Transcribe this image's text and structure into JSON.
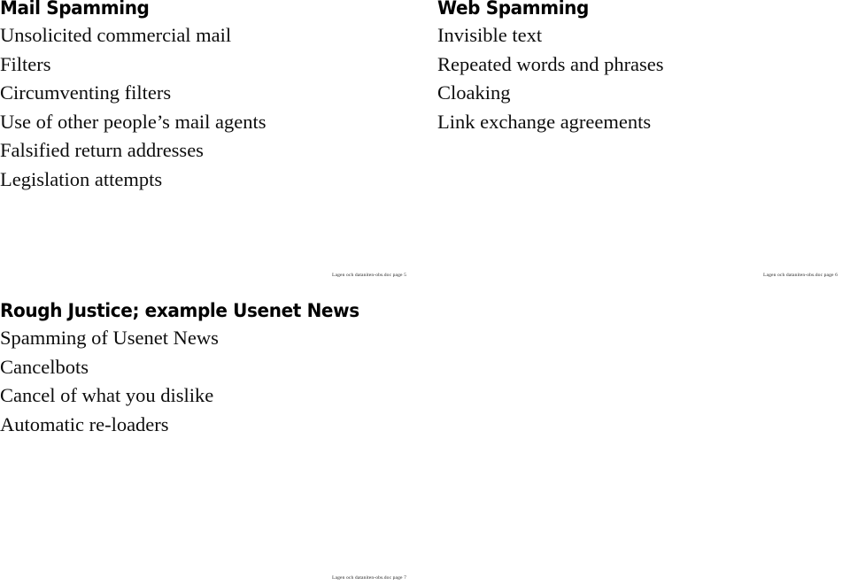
{
  "document": {
    "background_color": "#ffffff",
    "text_color": "#000000"
  },
  "slides": [
    {
      "id": "mail-spamming",
      "heading": "Mail Spamming",
      "lines": [
        "Unsolicited commercial mail",
        "Filters",
        "Circumventing filters",
        "Use of other people’s mail agents",
        "Falsified return addresses",
        "Legislation attempts"
      ]
    },
    {
      "id": "web-spamming",
      "heading": "Web Spamming",
      "lines": [
        "Invisible text",
        "Repeated words and phrases",
        "Cloaking",
        "Link exchange agreements"
      ]
    },
    {
      "id": "usenet-spamming",
      "heading": "Rough Justice; example Usenet News",
      "lines": [
        "Spamming of Usenet News",
        "Cancelbots",
        "Cancel of what you dislike",
        "Automatic re-loaders"
      ]
    }
  ],
  "footers": [
    {
      "id": "page-5",
      "text": "Lagen och dataniten-obs.doc  page 5"
    },
    {
      "id": "page-6",
      "text": "Lagen och dataniten-obs.doc  page 6"
    },
    {
      "id": "page-7",
      "text": "Lagen och dataniten-obs.doc  page 7"
    }
  ]
}
